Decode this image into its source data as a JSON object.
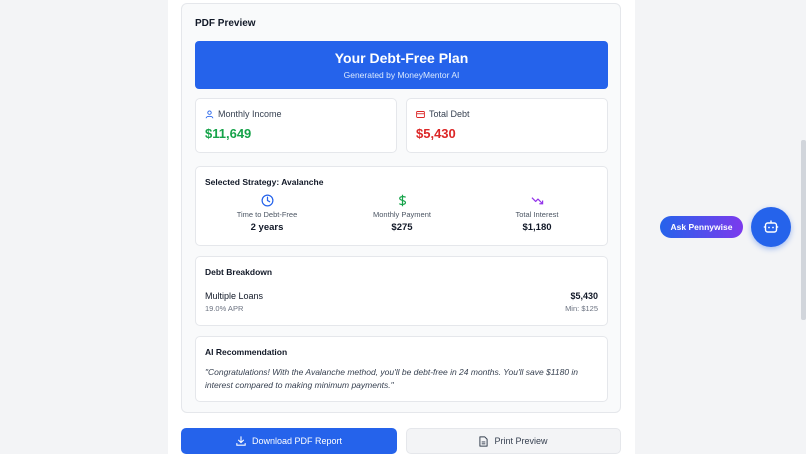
{
  "preview": {
    "title": "PDF Preview",
    "hero": {
      "title": "Your Debt-Free Plan",
      "subtitle": "Generated by MoneyMentor AI"
    },
    "income": {
      "label": "Monthly Income",
      "value": "$11,649",
      "color": "#16a34a",
      "icon": "user-icon"
    },
    "debt": {
      "label": "Total Debt",
      "value": "$5,430",
      "color": "#dc2626",
      "icon": "credit-card-icon"
    },
    "strategy": {
      "title": "Selected Strategy: Avalanche",
      "metrics": [
        {
          "label": "Time to Debt-Free",
          "value": "2 years",
          "icon": "clock-icon"
        },
        {
          "label": "Monthly Payment",
          "value": "$275",
          "icon": "dollar-icon"
        },
        {
          "label": "Total Interest",
          "value": "$1,180",
          "icon": "trending-down-icon"
        }
      ]
    },
    "breakdown": {
      "title": "Debt Breakdown",
      "items": [
        {
          "name": "Multiple Loans",
          "apr": "19.0% APR",
          "amount": "$5,430",
          "min": "Min: $125"
        }
      ]
    },
    "recommendation": {
      "title": "AI Recommendation",
      "text": "\"Congratulations! With the Avalanche method, you'll be debt-free in 24 months. You'll save $1180 in interest compared to making minimum payments.\""
    }
  },
  "actions": {
    "download_label": "Download PDF Report",
    "print_label": "Print Preview"
  },
  "assistant": {
    "label": "Ask Pennywise",
    "icon": "bot-icon"
  },
  "colors": {
    "accent": "#2563eb",
    "income": "#16a34a",
    "debt": "#dc2626",
    "interest": "#9333ea"
  }
}
